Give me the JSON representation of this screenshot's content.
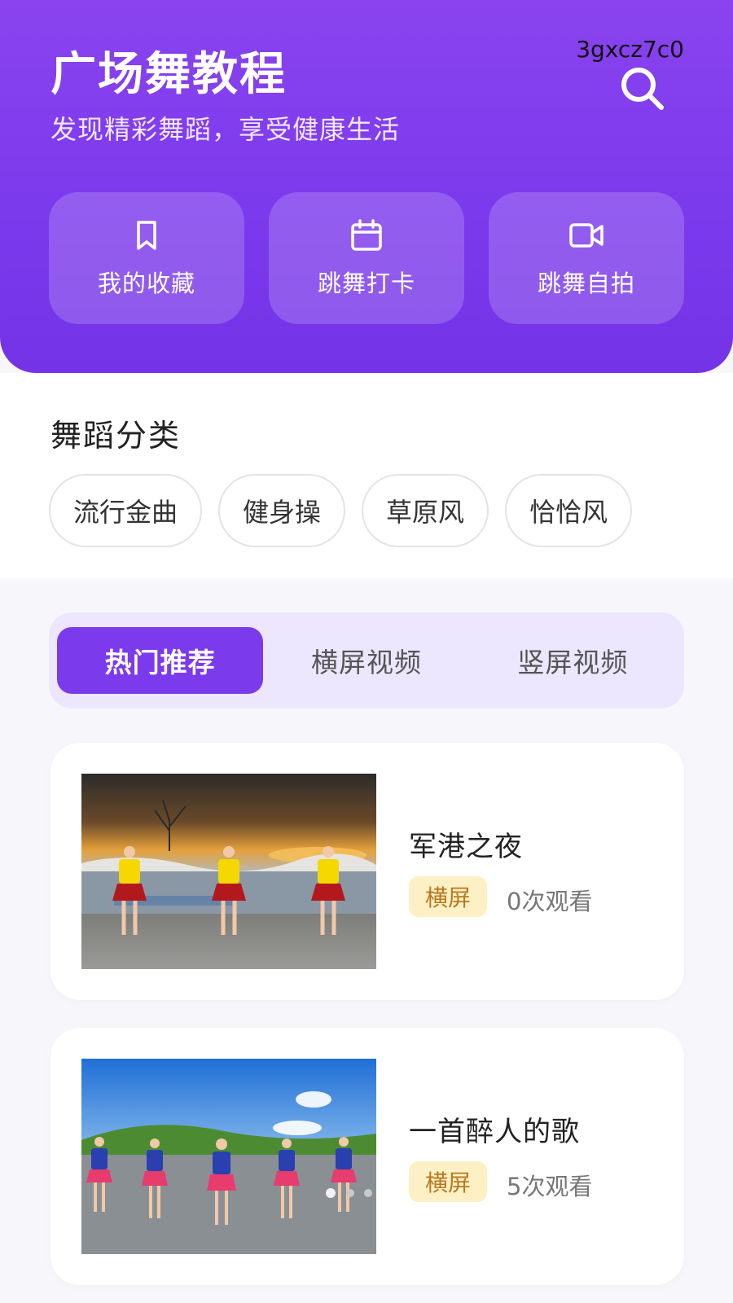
{
  "header": {
    "title": "广场舞教程",
    "subtitle": "发现精彩舞蹈，享受健康生活",
    "device_code": "3gxcz7c0",
    "search_icon": "search-icon",
    "quick_actions": [
      {
        "label": "我的收藏",
        "icon": "bookmark-icon"
      },
      {
        "label": "跳舞打卡",
        "icon": "calendar-icon"
      },
      {
        "label": "跳舞自拍",
        "icon": "video-camera-icon"
      }
    ]
  },
  "categories": {
    "title": "舞蹈分类",
    "items": [
      "流行金曲",
      "健身操",
      "草原风",
      "恰恰风"
    ]
  },
  "tabs": [
    {
      "label": "热门推荐",
      "active": true
    },
    {
      "label": "横屏视频",
      "active": false
    },
    {
      "label": "竖屏视频",
      "active": false
    }
  ],
  "videos": [
    {
      "title": "军港之夜",
      "badge": "横屏",
      "views": "0次观看"
    },
    {
      "title": "一首醉人的歌",
      "badge": "横屏",
      "views": "5次观看"
    }
  ],
  "colors": {
    "brand": "#7c3aed",
    "tab_bg": "#ece7ff",
    "badge_bg": "#fdf0c4",
    "badge_text": "#b7791f"
  }
}
